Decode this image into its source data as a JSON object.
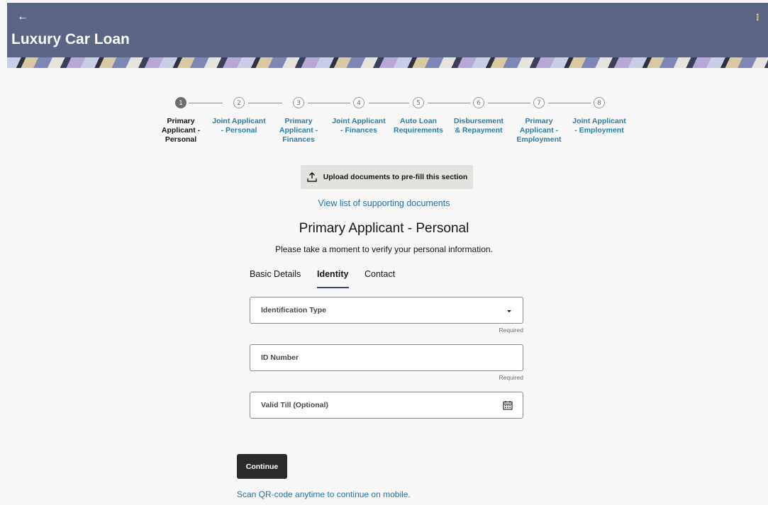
{
  "header": {
    "back_symbol": "←",
    "title": "Luxury Car Loan",
    "menu_symbol": "⁝"
  },
  "stepper": {
    "steps": [
      {
        "number": "1",
        "label_lines": [
          "Primary",
          "Applicant -",
          "Personal"
        ],
        "active": true
      },
      {
        "number": "2",
        "label_lines": [
          "Joint Applicant",
          "- Personal"
        ],
        "active": false
      },
      {
        "number": "3",
        "label_lines": [
          "Primary",
          "Applicant -",
          "Finances"
        ],
        "active": false
      },
      {
        "number": "4",
        "label_lines": [
          "Joint Applicant",
          "- Finances"
        ],
        "active": false
      },
      {
        "number": "5",
        "label_lines": [
          "Auto Loan",
          "Requirements"
        ],
        "active": false
      },
      {
        "number": "6",
        "label_lines": [
          "Disbursement",
          "& Repayment"
        ],
        "active": false
      },
      {
        "number": "7",
        "label_lines": [
          "Primary",
          "Applicant -",
          "Employment"
        ],
        "active": false
      },
      {
        "number": "8",
        "label_lines": [
          "Joint Applicant",
          "- Employment"
        ],
        "active": false
      }
    ]
  },
  "upload": {
    "label": "Upload documents to pre-fill this section"
  },
  "docs_link": "View list of supporting documents",
  "section": {
    "title": "Primary Applicant - Personal",
    "subtitle": "Please take a moment to verify your personal information."
  },
  "tabs": [
    {
      "label": "Basic Details",
      "active": false
    },
    {
      "label": "Identity",
      "active": true
    },
    {
      "label": "Contact",
      "active": false
    }
  ],
  "form": {
    "identification_type": {
      "label": "Identification Type",
      "helper": "Required"
    },
    "id_number": {
      "label": "ID Number",
      "helper": "Required"
    },
    "valid_till": {
      "label": "Valid Till (Optional)"
    }
  },
  "actions": {
    "continue_label": "Continue",
    "qr_text": "Scan QR-code anytime to continue on mobile."
  },
  "colors": {
    "header_bg": "#5a6585",
    "link": "#2474a6",
    "step_link": "#2b7ea6",
    "primary_button": "#2c2a28"
  }
}
